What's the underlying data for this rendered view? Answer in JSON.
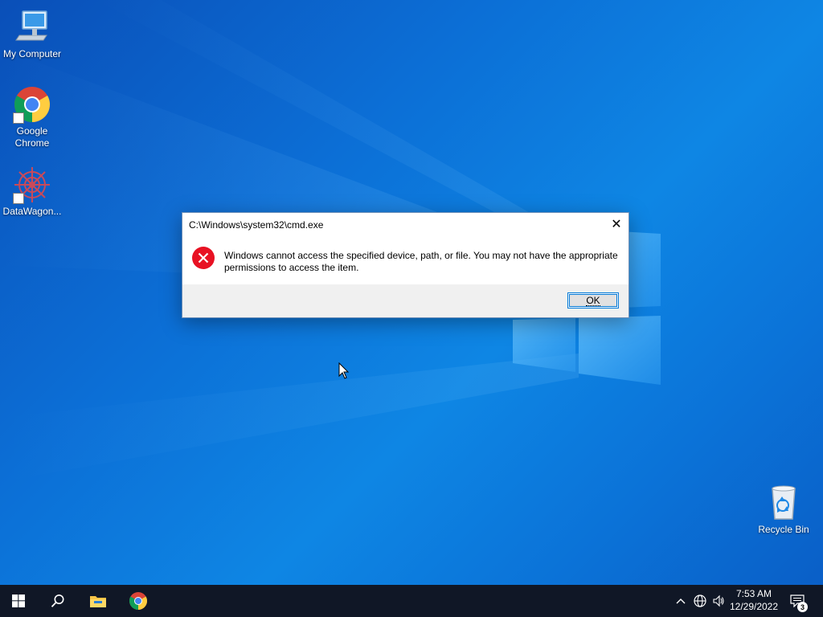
{
  "desktop": {
    "icons": [
      {
        "label": "My Computer",
        "icon": "monitor-icon"
      },
      {
        "label": "Google Chrome",
        "icon": "chrome-icon"
      },
      {
        "label": "DataWagon...",
        "icon": "datawagon-icon"
      },
      {
        "label": "Recycle Bin",
        "icon": "recycle-bin-icon"
      }
    ]
  },
  "dialog": {
    "title": "C:\\Windows\\system32\\cmd.exe",
    "message": "Windows cannot access the specified device, path, or file. You may not have the appropriate permissions to access the item.",
    "ok_label": "OK",
    "close_glyph": "✕",
    "icon": "error-icon"
  },
  "taskbar": {
    "apps": [
      "start-icon",
      "search-icon",
      "file-explorer-icon",
      "chrome-icon"
    ],
    "tray": {
      "time": "7:53 AM",
      "date": "12/29/2022",
      "notification_count": "3"
    }
  },
  "colors": {
    "accent": "#0078d7",
    "error_red": "#e81123",
    "taskbar": "#101726"
  }
}
